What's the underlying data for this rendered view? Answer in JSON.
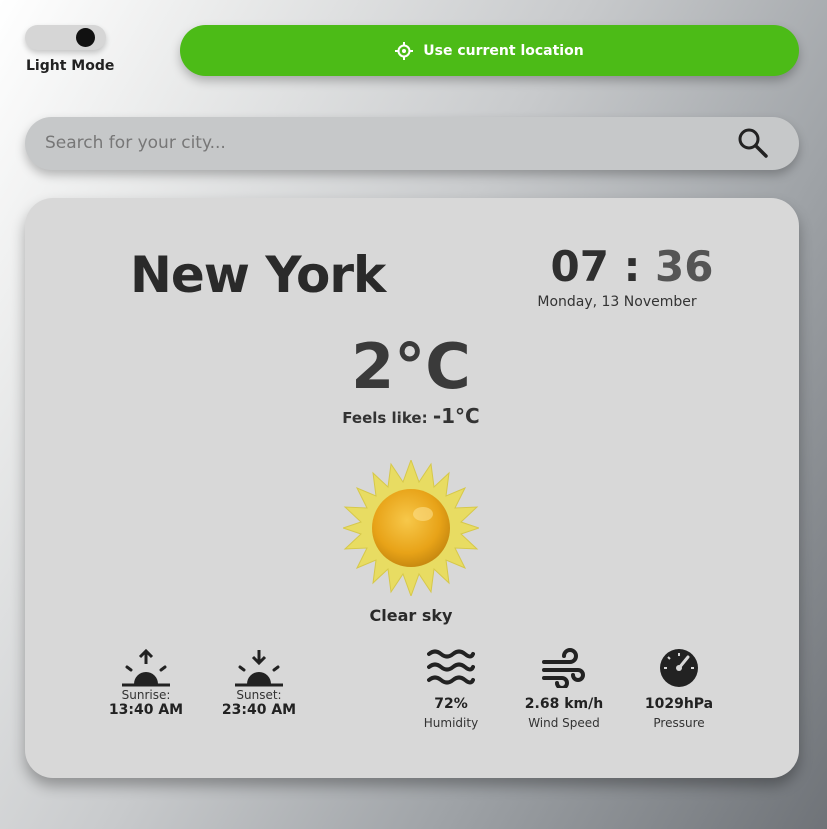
{
  "theme_toggle": {
    "label": "Light Mode"
  },
  "location_button": {
    "label": "Use current location"
  },
  "search": {
    "placeholder": "Search for your city..."
  },
  "weather": {
    "city": "New York",
    "time_hours": "07",
    "time_sep": ":",
    "time_minutes": "36",
    "date": "Monday, 13 November",
    "temperature": "2°C",
    "feels_like_label": "Feels like:",
    "feels_like_value": "-1°C",
    "condition": "Clear sky",
    "condition_icon": "sun-icon",
    "sunrise": {
      "label": "Sunrise:",
      "value": "13:40 AM",
      "icon": "sunrise-icon"
    },
    "sunset": {
      "label": "Sunset:",
      "value": "23:40 AM",
      "icon": "sunset-icon"
    },
    "humidity": {
      "value": "72%",
      "label": "Humidity",
      "icon": "humidity-icon"
    },
    "wind": {
      "value": "2.68 km/h",
      "label": "Wind Speed",
      "icon": "wind-icon"
    },
    "pressure": {
      "value": "1029hPa",
      "label": "Pressure",
      "icon": "pressure-gauge-icon"
    }
  },
  "colors": {
    "accent": "#4cbb17",
    "card": "#d8d8d8",
    "text": "#2a2a2a"
  }
}
